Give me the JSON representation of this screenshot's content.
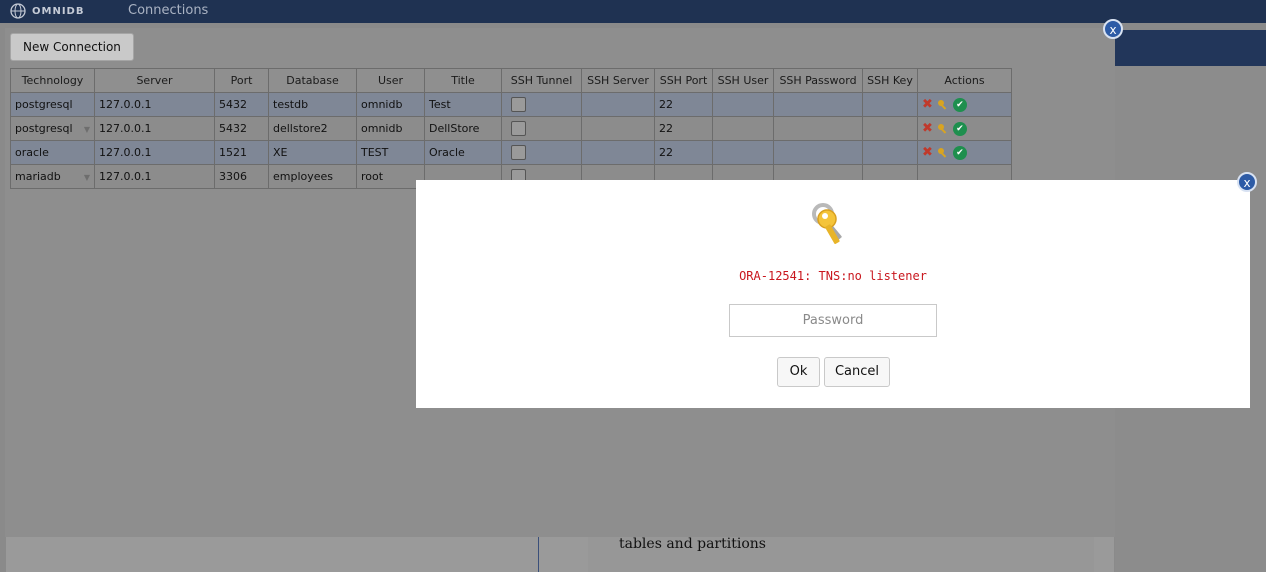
{
  "topbar": {
    "brand": "OMNIDB",
    "nav_link": "Connections"
  },
  "background": {
    "snippet": "tables and partitions"
  },
  "connections": {
    "new_button": "New Connection",
    "close_label": "x",
    "columns": [
      "Technology",
      "Server",
      "Port",
      "Database",
      "User",
      "Title",
      "SSH Tunnel",
      "SSH Server",
      "SSH Port",
      "SSH User",
      "SSH Password",
      "SSH Key",
      "Actions"
    ],
    "rows": [
      {
        "technology": "postgresql",
        "server": "127.0.0.1",
        "port": "5432",
        "database": "testdb",
        "user": "omnidb",
        "title": "Test",
        "ssh_port": "22"
      },
      {
        "technology": "postgresql",
        "server": "127.0.0.1",
        "port": "5432",
        "database": "dellstore2",
        "user": "omnidb",
        "title": "DellStore",
        "ssh_port": "22"
      },
      {
        "technology": "oracle",
        "server": "127.0.0.1",
        "port": "1521",
        "database": "XE",
        "user": "TEST",
        "title": "Oracle",
        "ssh_port": "22"
      },
      {
        "technology": "mariadb",
        "server": "127.0.0.1",
        "port": "3306",
        "database": "employees",
        "user": "root",
        "title": "",
        "ssh_port": ""
      }
    ]
  },
  "password_dialog": {
    "close_label": "x",
    "error_message": "ORA-12541: TNS:no listener",
    "password_placeholder": "Password",
    "ok_label": "Ok",
    "cancel_label": "Cancel"
  },
  "colors": {
    "topbar": "#1f3252",
    "accent": "#2d5ba6",
    "error": "#c9171e",
    "ok_icon": "#1e8f4e",
    "delete_icon": "#c0392b"
  },
  "icons": {
    "brand": "globe-icon",
    "dialog": "key-icon",
    "row_actions": [
      "delete-icon",
      "key-icon",
      "check-icon"
    ]
  }
}
